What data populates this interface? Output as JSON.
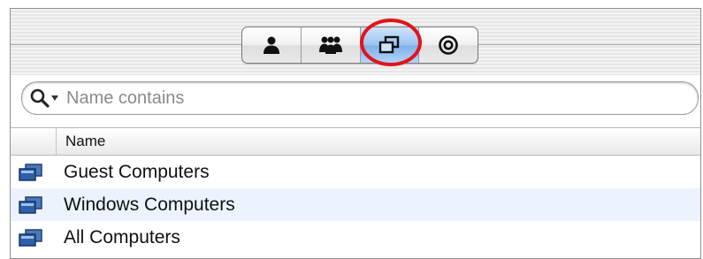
{
  "toolbar": {
    "segments": [
      {
        "icon": "single-user-icon",
        "selected": false
      },
      {
        "icon": "group-icon",
        "selected": false
      },
      {
        "icon": "computer-list-icon",
        "selected": true
      },
      {
        "icon": "target-icon",
        "selected": false
      }
    ],
    "selected_color": "#8fbcef",
    "highlight_color": "#e2141b"
  },
  "search": {
    "icon": "search-icon",
    "placeholder": "Name contains",
    "value": ""
  },
  "table": {
    "column_header": "Name",
    "rows": [
      {
        "icon": "computer-list-icon",
        "label": "Guest Computers"
      },
      {
        "icon": "computer-list-icon",
        "label": "Windows Computers"
      },
      {
        "icon": "computer-list-icon",
        "label": "All Computers"
      }
    ]
  }
}
